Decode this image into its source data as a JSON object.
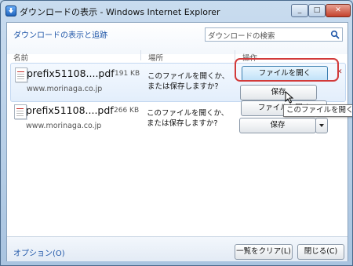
{
  "window": {
    "title": "ダウンロードの表示 - Windows Internet Explorer",
    "controls": {
      "minimize": "_",
      "maximize": "□",
      "close": "✕"
    }
  },
  "header": {
    "view_link": "ダウンロードの表示と追跡",
    "search_placeholder": "ダウンロードの検索"
  },
  "columns": {
    "name": "名前",
    "location": "場所",
    "action": "操作"
  },
  "downloads": [
    {
      "name": "prefix51108....pdf",
      "size": "191 KB",
      "source": "www.morinaga.co.jp",
      "location": "このファイルを開くか、または保存しますか?",
      "open_label": "ファイルを開く",
      "save_label": "保存"
    },
    {
      "name": "prefix51108....pdf",
      "size": "266 KB",
      "source": "www.morinaga.co.jp",
      "location": "このファイルを開くか、または保存しますか?",
      "open_label": "ファイルを開く",
      "save_label": "保存"
    }
  ],
  "tooltip": "このファイルを開く",
  "footer": {
    "options_link": "オプション(O)",
    "clear_label": "一覧をクリア(L)",
    "close_label": "閉じる(C)"
  },
  "colors": {
    "link": "#1f56a8",
    "highlight": "#d23a3a"
  }
}
